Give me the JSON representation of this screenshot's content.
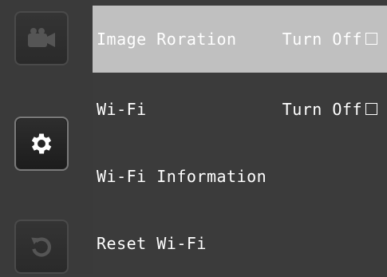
{
  "sidebar": {
    "buttons": [
      {
        "icon": "video-camera-icon",
        "state": "dimmed"
      },
      {
        "icon": "gear-icon",
        "state": "active"
      },
      {
        "icon": "reset-icon",
        "state": "dimmed"
      }
    ]
  },
  "menu": {
    "items": [
      {
        "label": "Image Roration",
        "state": "Turn Off",
        "checked": false,
        "selected": true
      },
      {
        "label": "Wi-Fi",
        "state": "Turn Off",
        "checked": false,
        "selected": false
      },
      {
        "label": "Wi-Fi Information"
      },
      {
        "label": "Reset Wi-Fi"
      }
    ]
  },
  "colors": {
    "background": "#3b3b3b",
    "selected_row": "#c0c0c0",
    "text": "#ffffff"
  }
}
